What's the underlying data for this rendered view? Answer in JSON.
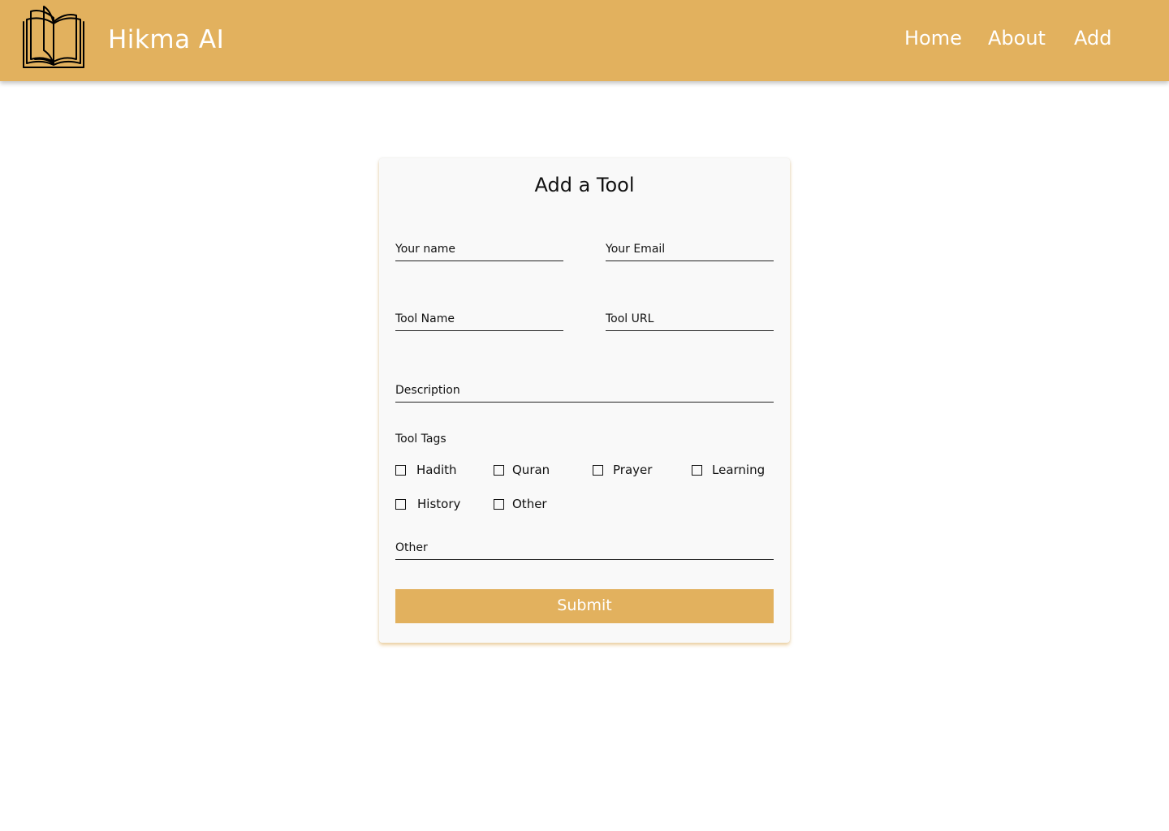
{
  "header": {
    "brand": "Hikma AI",
    "logo_icon": "open-book-icon",
    "nav": [
      "Home",
      "About",
      "Add"
    ]
  },
  "form": {
    "title": "Add a Tool",
    "fields": {
      "your_name": "Your name",
      "your_email": "Your Email",
      "tool_name": "Tool Name",
      "tool_url": "Tool URL",
      "description": "Description",
      "other": "Other"
    },
    "tags_label": "Tool Tags",
    "tags": [
      "Hadith",
      "Quran",
      "Prayer",
      "Learning",
      "History",
      "Other"
    ],
    "submit": "Submit"
  },
  "colors": {
    "accent": "#E2B15E",
    "card_background": "#F9F9F9",
    "text": "#111111"
  }
}
